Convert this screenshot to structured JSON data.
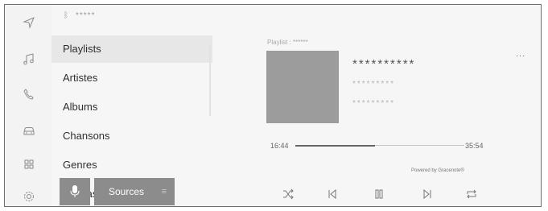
{
  "top_bar": {
    "bluetooth_icon": "bluetooth-icon",
    "device_name": "*****"
  },
  "sidebar": {
    "icons": [
      "navigation-icon",
      "music-icon",
      "phone-icon",
      "car-icon",
      "apps-icon",
      "settings-icon"
    ]
  },
  "browse_list": {
    "items": [
      {
        "label": "Playlists",
        "selected": true
      },
      {
        "label": "Artistes",
        "selected": false
      },
      {
        "label": "Albums",
        "selected": false
      },
      {
        "label": "Chansons",
        "selected": false
      },
      {
        "label": "Genres",
        "selected": false
      },
      {
        "label": "Podcasts",
        "selected": false
      }
    ]
  },
  "voice_button": {
    "icon": "microphone-icon"
  },
  "sources_button": {
    "label": "Sources",
    "icon": "menu-icon"
  },
  "now_playing": {
    "playlist_label": "Playlist : ******",
    "title": "**********",
    "artist": "*********",
    "album": "*********",
    "more_label": "...",
    "elapsed": "16:44",
    "duration": "35:54",
    "progress": 0.47,
    "powered_by": "Powered by Gracenote®"
  },
  "controls": [
    "shuffle-icon",
    "previous-icon",
    "pause-icon",
    "next-icon",
    "repeat-icon"
  ],
  "colors": {
    "accent": "#8c8c8c",
    "background": "#f6f6f6"
  }
}
